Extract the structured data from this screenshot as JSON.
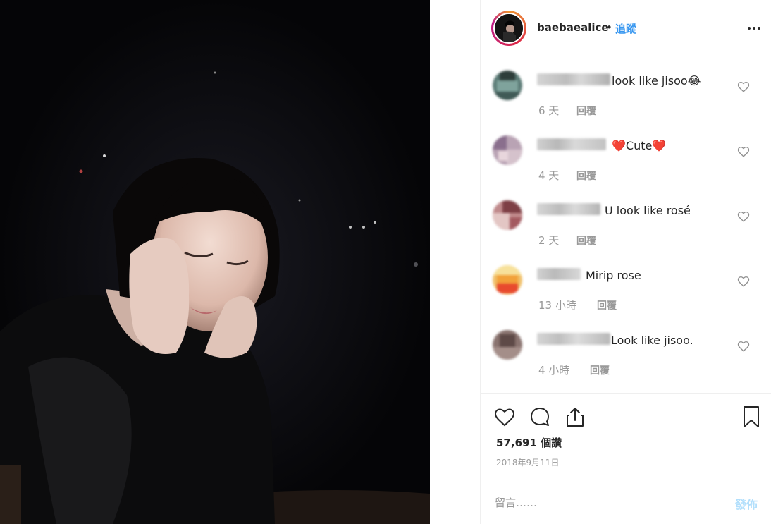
{
  "post": {
    "username": "baebaealice",
    "separator": "•",
    "follow_label": "追蹤",
    "more_icon": "more-horizontal-icon"
  },
  "comments": [
    {
      "text": "look like jisoo😂",
      "time": "6 天",
      "reply_label": "回覆"
    },
    {
      "text": "❤️Cute❤️",
      "time": "4 天",
      "reply_label": "回覆"
    },
    {
      "text": "U look like rosé",
      "time": "2 天",
      "reply_label": "回覆"
    },
    {
      "text": "Mirip rose",
      "time": "13 小時",
      "reply_label": "回覆"
    },
    {
      "text": "Look like jisoo.",
      "time": "4 小時",
      "reply_label": "回覆"
    }
  ],
  "actions": {
    "likes_text": "57,691 個讚",
    "date": "2018年9月11日",
    "icons": [
      "heart-icon",
      "comment-icon",
      "share-icon",
      "bookmark-icon"
    ]
  },
  "input": {
    "placeholder": "留言……",
    "post_label": "發佈"
  },
  "colors": {
    "accent": "#3897f0",
    "post_disabled": "#b2dffc",
    "muted": "#999999",
    "text": "#262626"
  }
}
